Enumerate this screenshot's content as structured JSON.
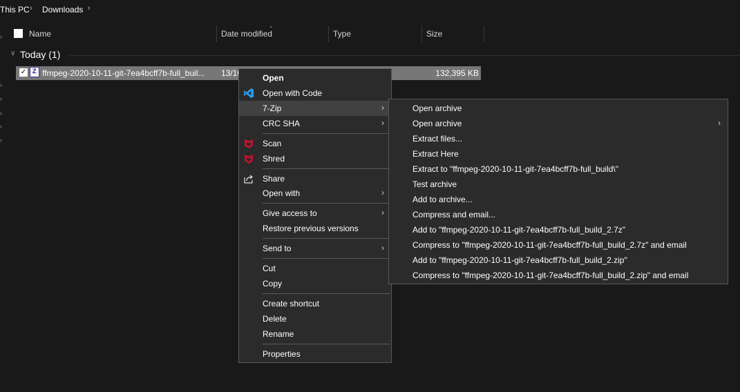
{
  "breadcrumb": {
    "items": [
      "This PC",
      "Downloads"
    ]
  },
  "columns": {
    "name": "Name",
    "date": "Date modified",
    "type": "Type",
    "size": "Size"
  },
  "group": {
    "label": "Today (1)"
  },
  "file": {
    "name": "ffmpeg-2020-10-11-git-7ea4bcff7b-full_buil...",
    "date": "13/10",
    "size": "132,395 KB",
    "icon": "zip-archive-icon"
  },
  "context_menu": {
    "items": [
      {
        "label": "Open",
        "bold": true
      },
      {
        "label": "Open with Code",
        "icon": "vscode-icon"
      },
      {
        "label": "7-Zip",
        "submenu": true,
        "highlighted": true
      },
      {
        "label": "CRC SHA",
        "submenu": true
      },
      {
        "label": "Scan",
        "icon": "mcafee-icon"
      },
      {
        "label": "Shred",
        "icon": "mcafee-icon"
      },
      {
        "label": "Share",
        "icon": "share-icon"
      },
      {
        "label": "Open with",
        "submenu": true
      },
      {
        "label": "Give access to",
        "submenu": true
      },
      {
        "label": "Restore previous versions"
      },
      {
        "label": "Send to",
        "submenu": true
      },
      {
        "label": "Cut"
      },
      {
        "label": "Copy"
      },
      {
        "label": "Create shortcut"
      },
      {
        "label": "Delete"
      },
      {
        "label": "Rename"
      },
      {
        "label": "Properties"
      }
    ]
  },
  "submenu_7zip": {
    "items": [
      {
        "label": "Open archive"
      },
      {
        "label": "Open archive",
        "submenu": true
      },
      {
        "label": "Extract files..."
      },
      {
        "label": "Extract Here"
      },
      {
        "label": "Extract to \"ffmpeg-2020-10-11-git-7ea4bcff7b-full_build\\\""
      },
      {
        "label": "Test archive"
      },
      {
        "label": "Add to archive..."
      },
      {
        "label": "Compress and email..."
      },
      {
        "label": "Add to \"ffmpeg-2020-10-11-git-7ea4bcff7b-full_build_2.7z\""
      },
      {
        "label": "Compress to \"ffmpeg-2020-10-11-git-7ea4bcff7b-full_build_2.7z\" and email"
      },
      {
        "label": "Add to \"ffmpeg-2020-10-11-git-7ea4bcff7b-full_build_2.zip\""
      },
      {
        "label": "Compress to \"ffmpeg-2020-10-11-git-7ea4bcff7b-full_build_2.zip\" and email"
      }
    ]
  },
  "colors": {
    "background": "#191919",
    "menu_bg": "#2b2b2b",
    "menu_highlight": "#414141",
    "selection": "#777777",
    "vscode_blue": "#2a9df4",
    "mcafee_red": "#c8102e"
  }
}
